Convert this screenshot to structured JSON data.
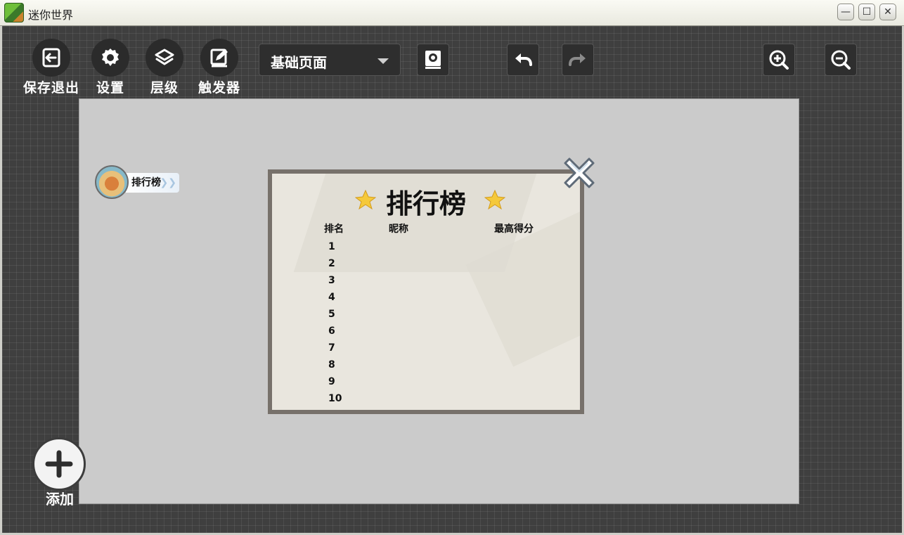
{
  "window": {
    "title": "迷你世界",
    "minimize": "—",
    "maximize": "☐",
    "close": "✕"
  },
  "toolbar": {
    "save_exit": "保存退出",
    "settings": "设置",
    "layers": "层级",
    "triggers": "触发器",
    "page_select": "基础页面"
  },
  "canvas": {
    "chip_label": "排行榜",
    "chip_chevron": "❯❯"
  },
  "leaderboard": {
    "title": "排行榜",
    "headers": {
      "rank": "排名",
      "nickname": "昵称",
      "score": "最高得分"
    },
    "ranks": [
      "1",
      "2",
      "3",
      "4",
      "5",
      "6",
      "7",
      "8",
      "9",
      "10"
    ]
  },
  "add": {
    "label": "添加"
  },
  "icons": {
    "app": "app-logo-icon",
    "save_exit": "exit-icon",
    "settings": "gear-icon",
    "layers": "layers-icon",
    "triggers": "edit-icon",
    "preview": "device-preview-icon",
    "undo": "undo-icon",
    "redo": "redo-icon",
    "zoom_in": "zoom-in-icon",
    "zoom_out": "zoom-out-icon",
    "close": "close-x-icon",
    "add": "plus-icon"
  },
  "colors": {
    "toolbar_bg": "#3f3f3f",
    "canvas_bg": "#cbcbcb",
    "board_bg": "#e9e6de",
    "board_border": "#77716b",
    "star": "#f5c93a"
  }
}
